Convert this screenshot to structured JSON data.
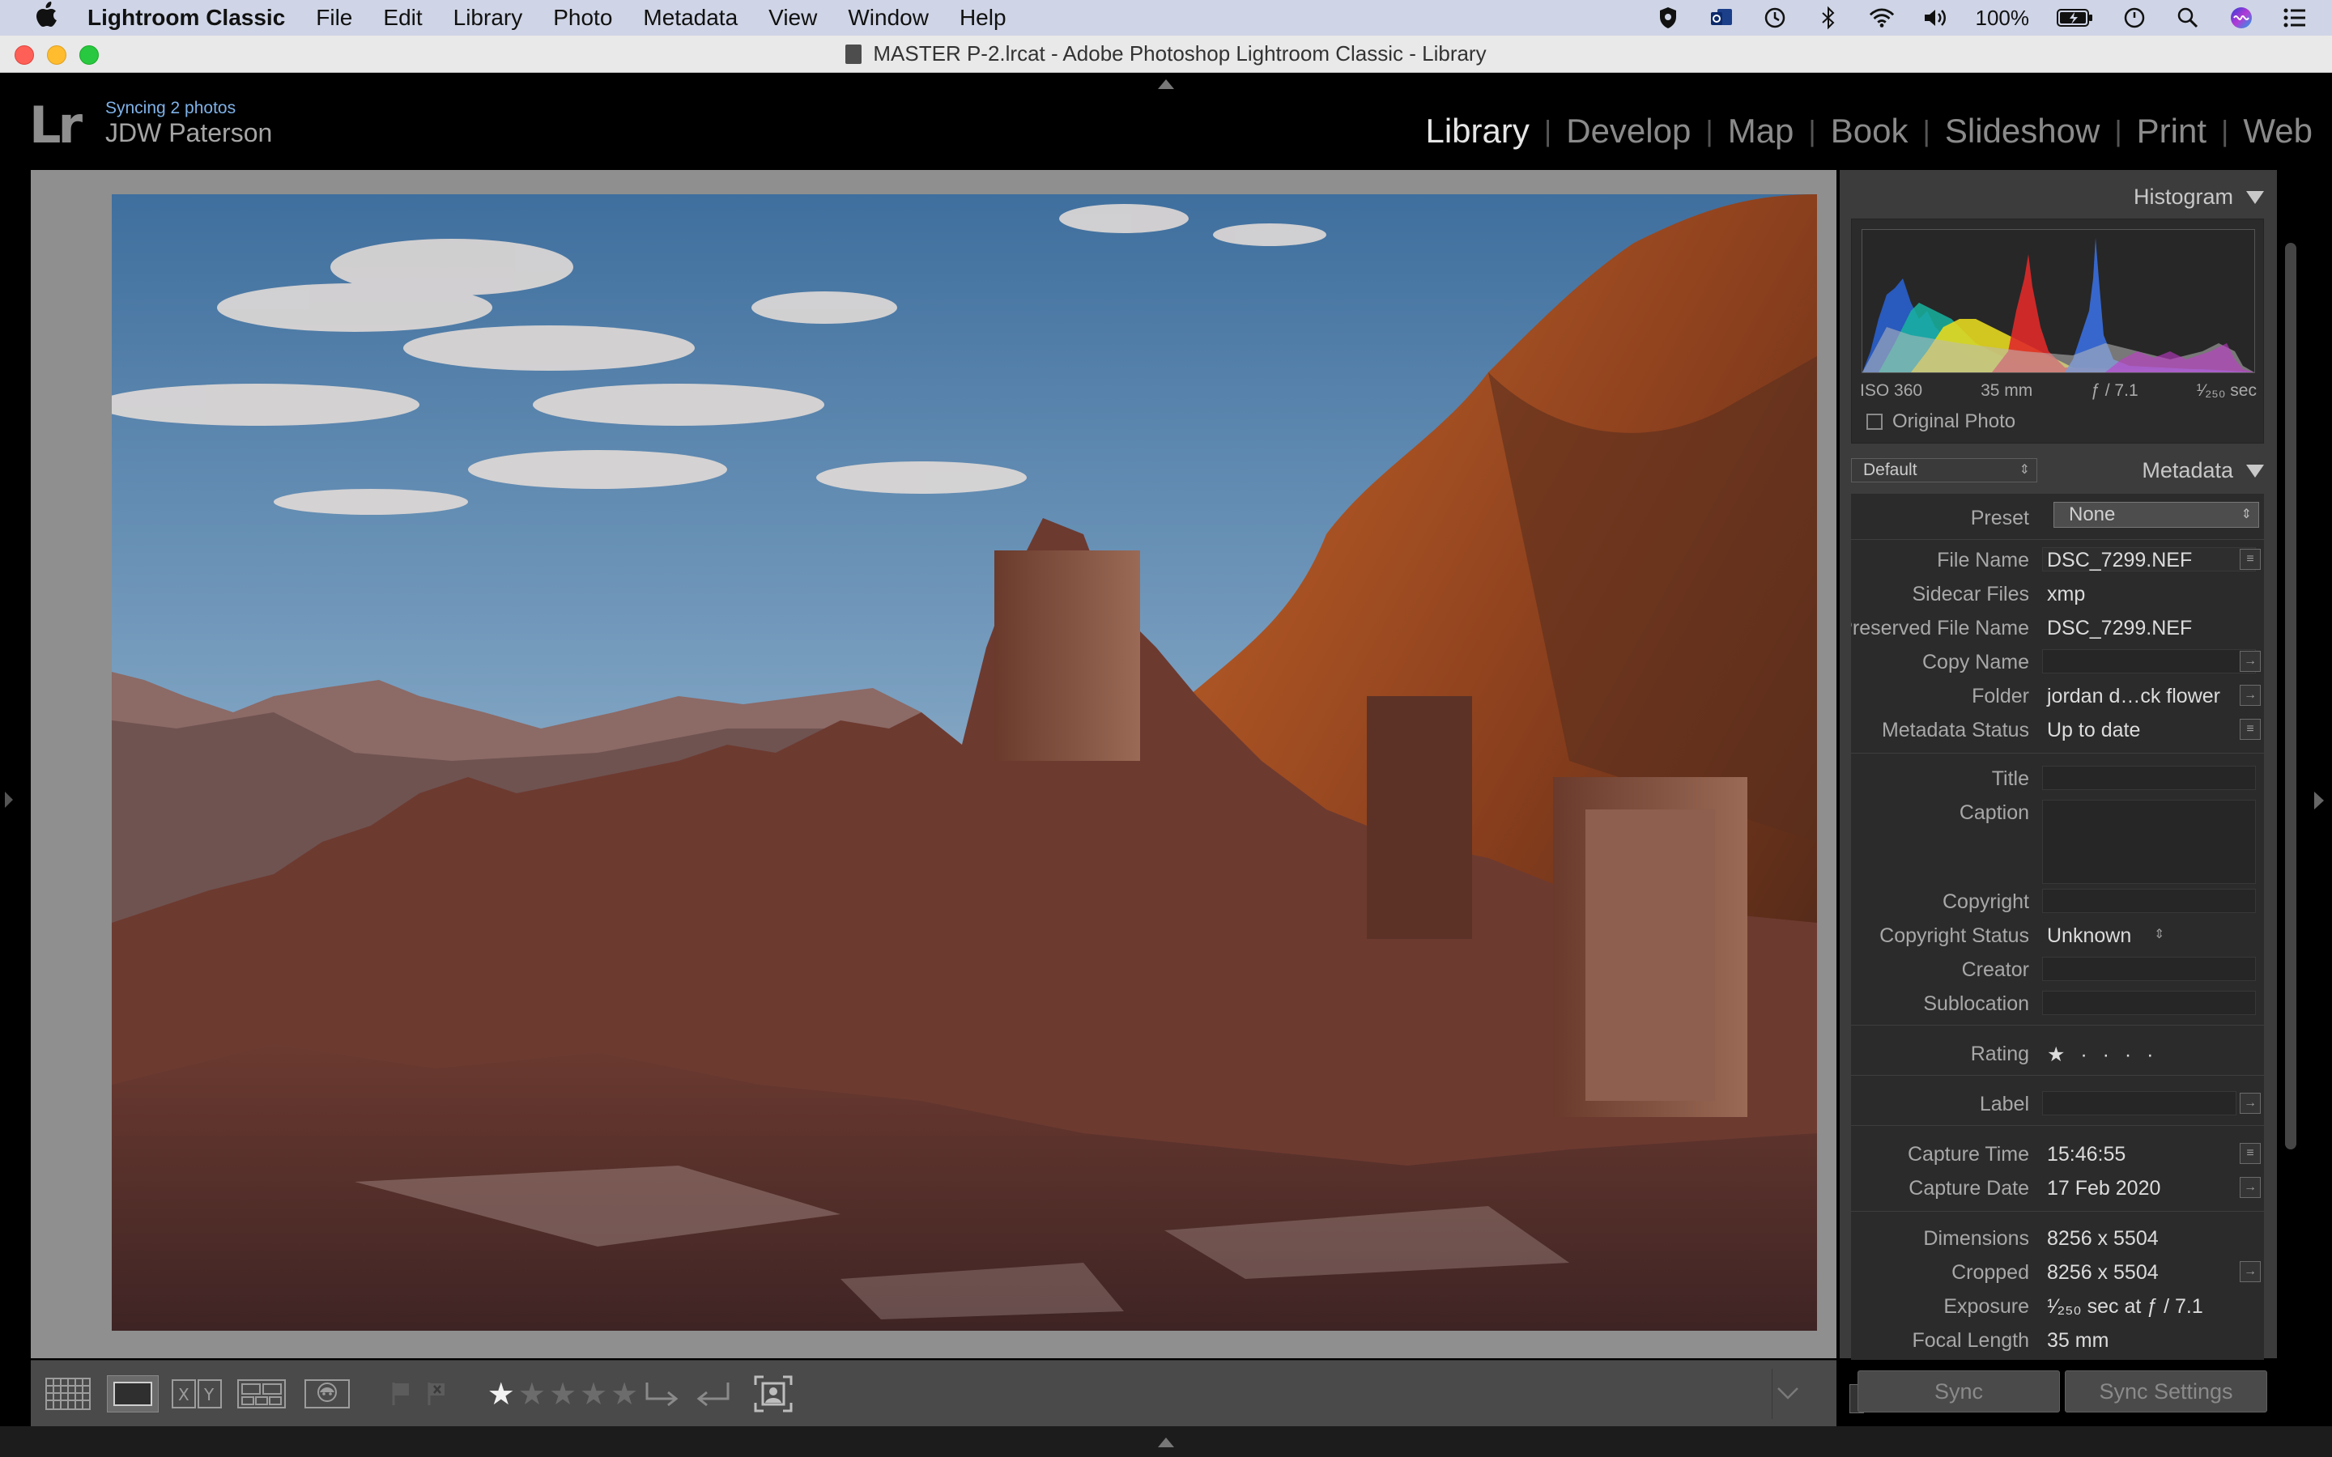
{
  "menubar": {
    "app": "Lightroom Classic",
    "items": [
      "File",
      "Edit",
      "Library",
      "Photo",
      "Metadata",
      "View",
      "Window",
      "Help"
    ],
    "battery": "100%"
  },
  "window": {
    "title": "MASTER P-2.lrcat - Adobe Photoshop Lightroom Classic - Library"
  },
  "identity": {
    "logo": "Lr",
    "status": "Syncing 2 photos",
    "user": "JDW Paterson"
  },
  "modules": [
    "Library",
    "Develop",
    "Map",
    "Book",
    "Slideshow",
    "Print",
    "Web"
  ],
  "histogram": {
    "title": "Histogram",
    "iso": "ISO 360",
    "focal": "35 mm",
    "aperture": "ƒ / 7.1",
    "shutter": "¹⁄₂₅₀ sec",
    "original_photo": "Original Photo"
  },
  "metadata": {
    "title": "Metadata",
    "default_select": "Default",
    "preset_label": "Preset",
    "preset_value": "None",
    "rows": [
      {
        "label": "File Name",
        "value": "DSC_7299.NEF"
      },
      {
        "label": "Sidecar Files",
        "value": "xmp"
      },
      {
        "label": "Preserved File Name",
        "value": "DSC_7299.NEF"
      },
      {
        "label": "Copy Name",
        "value": ""
      },
      {
        "label": "Folder",
        "value": "jordan d…ck flower"
      },
      {
        "label": "Metadata Status",
        "value": "Up to date"
      },
      {
        "label": "Title",
        "value": ""
      },
      {
        "label": "Caption",
        "value": ""
      },
      {
        "label": "Copyright",
        "value": ""
      },
      {
        "label": "Copyright Status",
        "value": "Unknown"
      },
      {
        "label": "Creator",
        "value": ""
      },
      {
        "label": "Sublocation",
        "value": ""
      },
      {
        "label": "Rating",
        "value": "★ · · · ·"
      },
      {
        "label": "Label",
        "value": ""
      },
      {
        "label": "Capture Time",
        "value": "15:46:55"
      },
      {
        "label": "Capture Date",
        "value": "17 Feb 2020"
      },
      {
        "label": "Dimensions",
        "value": "8256 x 5504"
      },
      {
        "label": "Cropped",
        "value": "8256 x 5504"
      },
      {
        "label": "Exposure",
        "value": "¹⁄₂₅₀ sec at ƒ / 7.1"
      },
      {
        "label": "Focal Length",
        "value": "35 mm"
      }
    ]
  },
  "toolbar": {
    "rating_stars": 1
  },
  "sync": {
    "sync_label": "Sync",
    "sync_settings_label": "Sync Settings"
  }
}
